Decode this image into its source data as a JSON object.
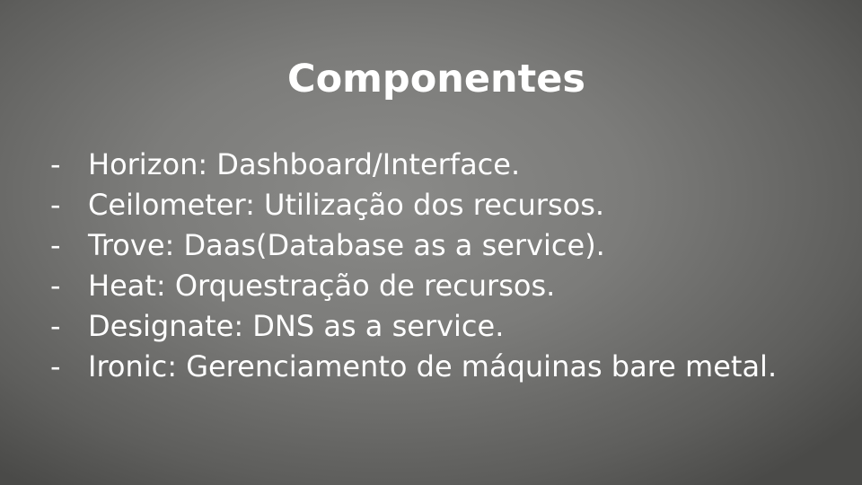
{
  "slide": {
    "title": "Componentes",
    "bullet_marker": "-",
    "items": [
      {
        "text": "Horizon: Dashboard/Interface."
      },
      {
        "text": "Ceilometer: Utilização dos recursos."
      },
      {
        "text": "Trove: Daas(Database as a service)."
      },
      {
        "text": "Heat: Orquestração de recursos."
      },
      {
        "text": "Designate: DNS as a service."
      },
      {
        "text": "Ironic: Gerenciamento de máquinas bare metal."
      }
    ]
  },
  "colors": {
    "text": "#ffffff",
    "background": "#7c7c7a"
  }
}
